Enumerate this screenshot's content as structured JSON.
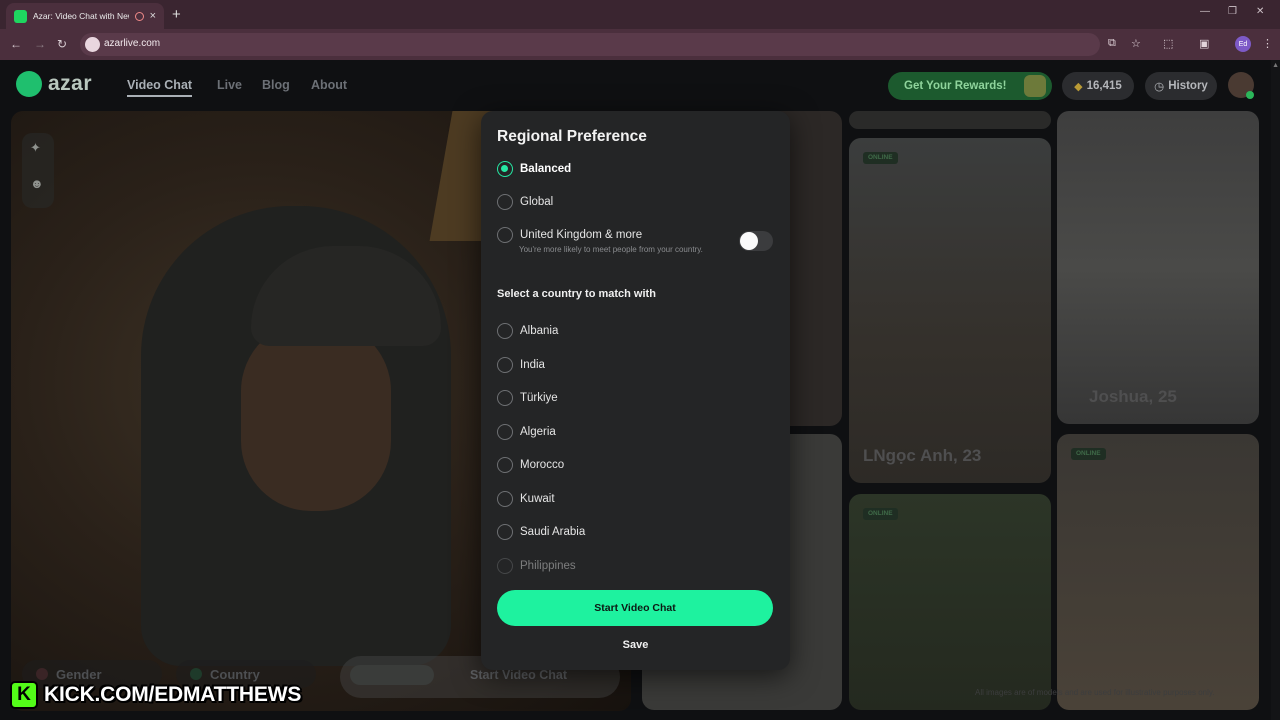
{
  "browser": {
    "tab_title": "Azar: Video Chat with New",
    "tab_close": "×",
    "new_tab": "+",
    "url": "azarlive.com",
    "profile_initials": "Ed",
    "controls": {
      "minimize": "—",
      "restore": "❐",
      "close": "✕"
    }
  },
  "nav": {
    "logo_text": "azar",
    "links": [
      "Video Chat",
      "Live",
      "Blog",
      "About"
    ],
    "rewards_label": "Get Your Rewards!",
    "gems_count": "16,415",
    "history_label": "History"
  },
  "video": {
    "filters": {
      "gender_label": "Gender",
      "country_label": "Country"
    },
    "start_label": "Start Video Chat"
  },
  "cards": [
    {
      "name": "LNgọc Anh, 23",
      "badge": "ONLINE"
    },
    {
      "name": "Joshua, 25",
      "badge": ""
    },
    {
      "name": "",
      "badge": "ONLINE"
    },
    {
      "name": "",
      "badge": "ONLINE"
    }
  ],
  "disclaimer": "All images are of models and are used for illustrative purposes only.",
  "modal": {
    "title": "Regional Preference",
    "options": [
      {
        "label": "Balanced",
        "selected": true
      },
      {
        "label": "Global",
        "selected": false
      },
      {
        "label": "United Kingdom & more",
        "selected": false
      }
    ],
    "uk_subtext": "You're more likely to meet people from your country.",
    "toggle_on": false,
    "country_section_title": "Select a country to match with",
    "countries": [
      "Albania",
      "India",
      "Türkiye",
      "Algeria",
      "Morocco",
      "Kuwait",
      "Saudi Arabia",
      "Philippines"
    ],
    "start_button": "Start Video Chat",
    "save_button": "Save"
  },
  "overlay": {
    "kick_letter": "K",
    "kick_text": "KICK.COM/EDMATTHEWS"
  },
  "colors": {
    "accent": "#1ef29f",
    "modal_bg": "#242526",
    "kick_green": "#53fc18"
  }
}
